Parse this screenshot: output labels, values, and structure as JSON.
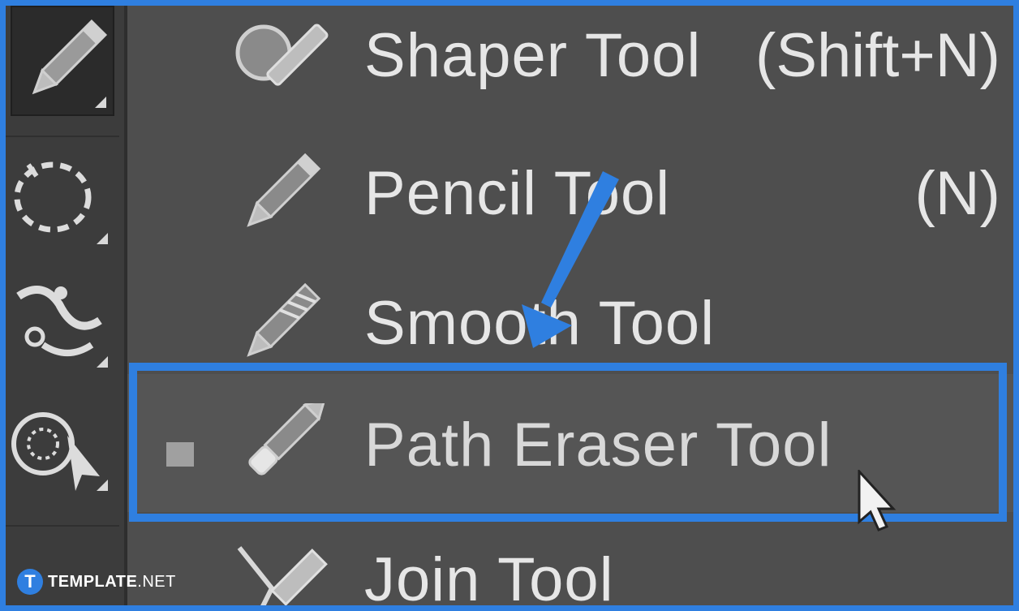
{
  "menu": {
    "items": [
      {
        "label": "Shaper Tool",
        "shortcut": "(Shift+N)",
        "icon": "shaper-icon"
      },
      {
        "label": "Pencil Tool",
        "shortcut": "(N)",
        "icon": "pencil-icon"
      },
      {
        "label": "Smooth Tool",
        "shortcut": "",
        "icon": "smooth-icon"
      },
      {
        "label": "Path Eraser Tool",
        "shortcut": "",
        "icon": "path-eraser-icon",
        "selected": true
      },
      {
        "label": "Join Tool",
        "shortcut": "",
        "icon": "join-icon"
      }
    ]
  },
  "toolbar": {
    "icons": [
      "pencil-icon",
      "lasso-icon",
      "puppet-warp-icon",
      "perspective-icon"
    ]
  },
  "watermark": {
    "logo_letter": "T",
    "brand": "TEMPLATE",
    "suffix": ".NET"
  },
  "colors": {
    "accent": "#2f7fe0",
    "menu_bg": "#4e4e4e",
    "toolbar_bg": "#3c3c3c",
    "text": "#e6e6e6"
  }
}
